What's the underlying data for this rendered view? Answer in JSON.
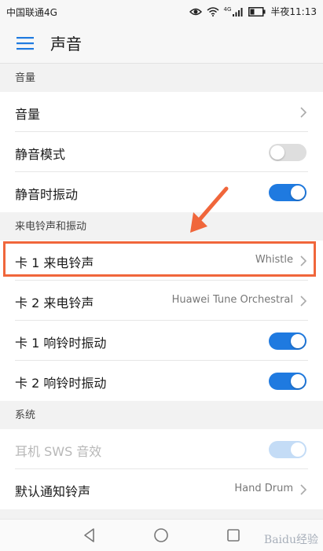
{
  "status_bar": {
    "carrier": "中国联通4G",
    "network_tag": "4G",
    "time": "半夜11:13"
  },
  "app_bar": {
    "title": "声音",
    "menu_icon": "hamburger-menu-icon"
  },
  "sections": {
    "volume": {
      "header": "音量"
    },
    "ringtone": {
      "header": "来电铃声和振动"
    },
    "system": {
      "header": "系统"
    }
  },
  "rows": {
    "volume": {
      "label": "音量"
    },
    "silent_mode": {
      "label": "静音模式",
      "toggle": "off"
    },
    "vibrate_on_silent": {
      "label": "静音时振动",
      "toggle": "on"
    },
    "sim1_ringtone": {
      "label": "卡 1 来电铃声",
      "value": "Whistle"
    },
    "sim2_ringtone": {
      "label": "卡 2 来电铃声",
      "value": "Huawei Tune Orchestral"
    },
    "sim1_vibrate": {
      "label": "卡 1 响铃时振动",
      "toggle": "on"
    },
    "sim2_vibrate": {
      "label": "卡 2 响铃时振动",
      "toggle": "on"
    },
    "sws_effect": {
      "label": "耳机 SWS 音效",
      "toggle": "on-disabled"
    },
    "default_notification": {
      "label": "默认通知铃声",
      "value": "Hand Drum"
    }
  },
  "colors": {
    "accent": "#1f7ae0",
    "highlight": "#f0663b"
  },
  "watermark": "Baidu经验"
}
